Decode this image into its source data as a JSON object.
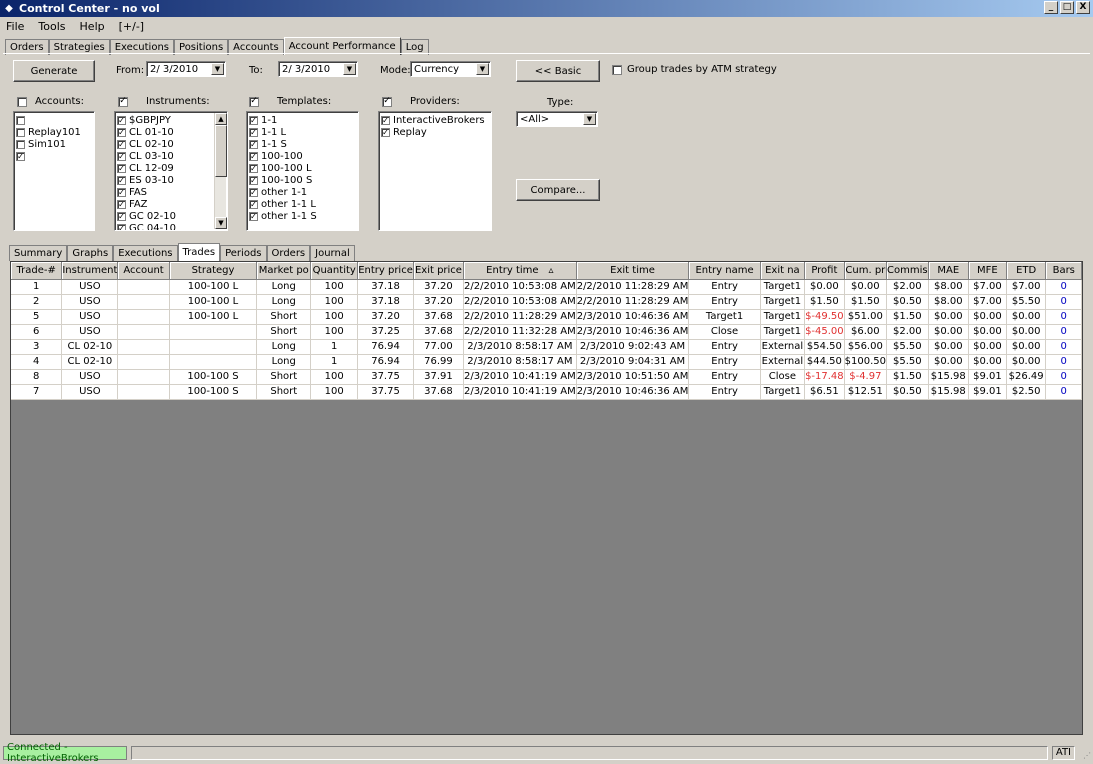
{
  "window": {
    "title": "Control Center - no vol",
    "minimize": "_",
    "maximize": "□",
    "close": "X"
  },
  "menu": [
    "File",
    "Tools",
    "Help",
    "[+/-]"
  ],
  "top_tabs": [
    "Orders",
    "Strategies",
    "Executions",
    "Positions",
    "Accounts",
    "Account Performance",
    "Log"
  ],
  "top_tabs_active": "Account Performance",
  "controls": {
    "generate": "Generate",
    "from_label": "From:",
    "from_value": "2/ 3/2010",
    "to_label": "To:",
    "to_value": "2/ 3/2010",
    "mode_label": "Mode:",
    "mode_value": "Currency",
    "basic_button": "<< Basic",
    "group_label": "Group trades by ATM strategy",
    "compare_button": "Compare...",
    "type_label": "Type:",
    "type_value": "<All>"
  },
  "accounts": {
    "label": "Accounts:",
    "header_checked": false,
    "items": [
      {
        "label": "",
        "checked": false
      },
      {
        "label": "Replay101",
        "checked": false
      },
      {
        "label": "Sim101",
        "checked": false
      },
      {
        "label": "",
        "checked": true
      }
    ]
  },
  "instruments": {
    "label": "Instruments:",
    "header_checked": true,
    "items": [
      "$GBPJPY",
      "CL 01-10",
      "CL 02-10",
      "CL 03-10",
      "CL 12-09",
      "ES 03-10",
      "FAS",
      "FAZ",
      "GC 02-10",
      "GC 04-10"
    ]
  },
  "templates": {
    "label": "Templates:",
    "header_checked": true,
    "items": [
      "1-1",
      "1-1 L",
      "1-1 S",
      "100-100",
      "100-100 L",
      "100-100 S",
      "other 1-1",
      "other 1-1 L",
      "other 1-1 S"
    ]
  },
  "providers": {
    "label": "Providers:",
    "header_checked": true,
    "items": [
      "InteractiveBrokers",
      "Replay"
    ]
  },
  "sub_tabs": [
    "Summary",
    "Graphs",
    "Executions",
    "Trades",
    "Periods",
    "Orders",
    "Journal"
  ],
  "sub_tabs_active": "Trades",
  "trades": {
    "columns": [
      "Trade-#",
      "Instrument",
      "Account",
      "Strategy",
      "Market po",
      "Quantity",
      "Entry price",
      "Exit price",
      "Entry time",
      "Exit time",
      "Entry name",
      "Exit na",
      "Profit",
      "Cum. pr",
      "Commis",
      "MAE",
      "MFE",
      "ETD",
      "Bars"
    ],
    "sort_indicator": "▵",
    "rows": [
      [
        "1",
        "USO",
        "",
        "100-100 L",
        "Long",
        "100",
        "37.18",
        "37.20",
        "2/2/2010 10:53:08 AM",
        "2/2/2010 11:28:29 AM",
        "Entry",
        "Target1",
        "$0.00",
        "$0.00",
        "$2.00",
        "$8.00",
        "$7.00",
        "$7.00",
        "0"
      ],
      [
        "2",
        "USO",
        "",
        "100-100 L",
        "Long",
        "100",
        "37.18",
        "37.20",
        "2/2/2010 10:53:08 AM",
        "2/2/2010 11:28:29 AM",
        "Entry",
        "Target1",
        "$1.50",
        "$1.50",
        "$0.50",
        "$8.00",
        "$7.00",
        "$5.50",
        "0"
      ],
      [
        "5",
        "USO",
        "",
        "100-100 L",
        "Short",
        "100",
        "37.20",
        "37.68",
        "2/2/2010 11:28:29 AM",
        "2/3/2010 10:46:36 AM",
        "Target1",
        "Target1",
        "$-49.50",
        "$51.00",
        "$1.50",
        "$0.00",
        "$0.00",
        "$0.00",
        "0"
      ],
      [
        "6",
        "USO",
        "",
        "",
        "Short",
        "100",
        "37.25",
        "37.68",
        "2/2/2010 11:32:28 AM",
        "2/3/2010 10:46:36 AM",
        "Close",
        "Target1",
        "$-45.00",
        "$6.00",
        "$2.00",
        "$0.00",
        "$0.00",
        "$0.00",
        "0"
      ],
      [
        "3",
        "CL 02-10",
        "",
        "",
        "Long",
        "1",
        "76.94",
        "77.00",
        "2/3/2010 8:58:17 AM",
        "2/3/2010 9:02:43 AM",
        "Entry",
        "External",
        "$54.50",
        "$56.00",
        "$5.50",
        "$0.00",
        "$0.00",
        "$0.00",
        "0"
      ],
      [
        "4",
        "CL 02-10",
        "",
        "",
        "Long",
        "1",
        "76.94",
        "76.99",
        "2/3/2010 8:58:17 AM",
        "2/3/2010 9:04:31 AM",
        "Entry",
        "External",
        "$44.50",
        "$100.50",
        "$5.50",
        "$0.00",
        "$0.00",
        "$0.00",
        "0"
      ],
      [
        "8",
        "USO",
        "",
        "100-100 S",
        "Short",
        "100",
        "37.75",
        "37.91",
        "2/3/2010 10:41:19 AM",
        "2/3/2010 10:51:50 AM",
        "Entry",
        "Close",
        "$-17.48",
        "$-4.97",
        "$1.50",
        "$15.98",
        "$9.01",
        "$26.49",
        "0"
      ],
      [
        "7",
        "USO",
        "",
        "100-100 S",
        "Short",
        "100",
        "37.75",
        "37.68",
        "2/3/2010 10:41:19 AM",
        "2/3/2010 10:46:36 AM",
        "Entry",
        "Target1",
        "$6.51",
        "$12.51",
        "$0.50",
        "$15.98",
        "$9.01",
        "$2.50",
        "0"
      ]
    ]
  },
  "status": {
    "connection": "Connected - InteractiveBrokers",
    "right": "ATI"
  },
  "colors": {
    "connected_bg": "#a8f0a0",
    "negative": "#e03030",
    "bars_blue": "#0000c0",
    "grid_empty": "#808080"
  }
}
